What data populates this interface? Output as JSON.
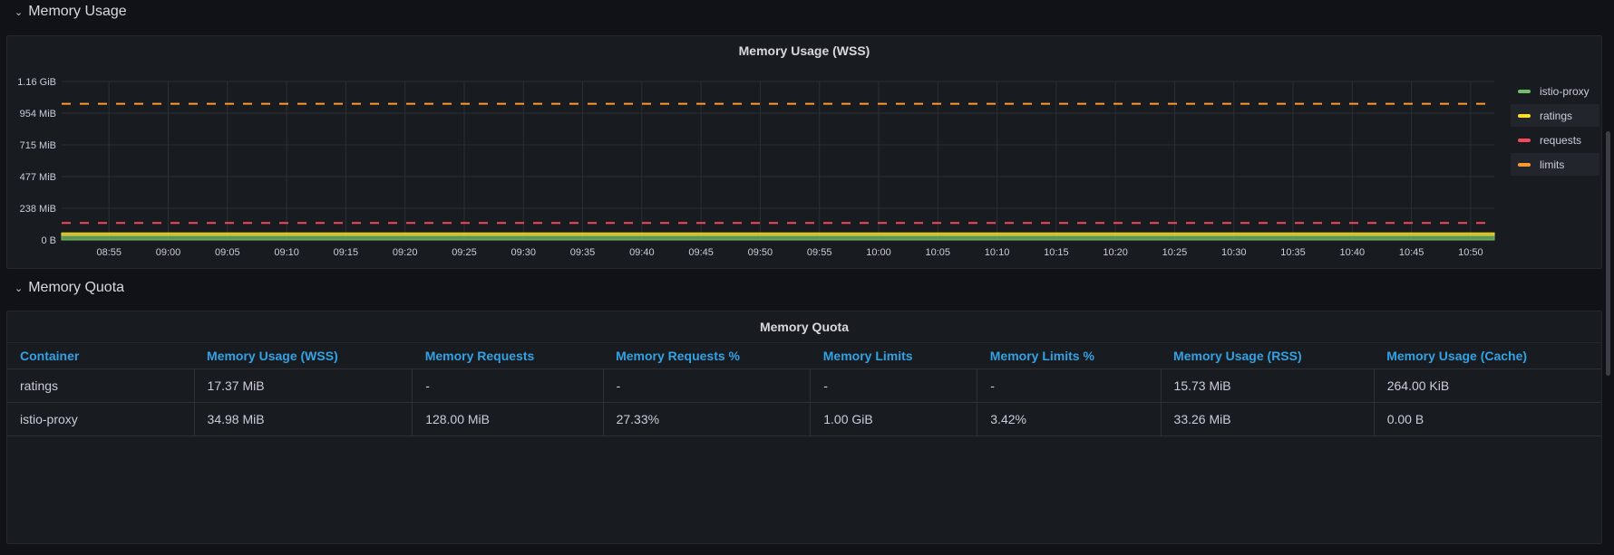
{
  "rows": {
    "memory_usage": "Memory Usage",
    "memory_quota": "Memory Quota"
  },
  "icons": {
    "collapse": "chevron-down-icon"
  },
  "colors": {
    "istio_proxy": "#73bf69",
    "ratings": "#fade2a",
    "requests": "#f2495c",
    "limits": "#ff9830",
    "header_link": "#33a2e5"
  },
  "wss_panel": {
    "title": "Memory Usage (WSS)",
    "legend": [
      {
        "label": "istio-proxy",
        "color": "#73bf69",
        "highlight": false
      },
      {
        "label": "ratings",
        "color": "#fade2a",
        "highlight": true
      },
      {
        "label": "requests",
        "color": "#f2495c",
        "highlight": false
      },
      {
        "label": "limits",
        "color": "#ff9830",
        "highlight": true
      }
    ]
  },
  "chart_data": {
    "type": "area",
    "title": "Memory Usage (WSS)",
    "y_tick_labels": [
      "0 B",
      "238 MiB",
      "477 MiB",
      "715 MiB",
      "954 MiB",
      "1.16 GiB"
    ],
    "y_tick_values_mib": [
      0,
      238,
      477,
      715,
      954,
      1192
    ],
    "ylim_mib": [
      0,
      1192
    ],
    "x_tick_labels": [
      "08:55",
      "09:00",
      "09:05",
      "09:10",
      "09:15",
      "09:20",
      "09:25",
      "09:30",
      "09:35",
      "09:40",
      "09:45",
      "09:50",
      "09:55",
      "10:00",
      "10:05",
      "10:10",
      "10:15",
      "10:20",
      "10:25",
      "10:30",
      "10:35",
      "10:40",
      "10:45",
      "10:50"
    ],
    "x_range": [
      "08:51",
      "10:52"
    ],
    "grid": true,
    "legend_placement": "right",
    "series": [
      {
        "name": "istio-proxy",
        "kind": "stacked-area",
        "color": "#73bf69",
        "values_mib": [
          35,
          35,
          35,
          35,
          35,
          35
        ]
      },
      {
        "name": "ratings",
        "kind": "stacked-area",
        "color": "#fade2a",
        "values_mib": [
          17.4,
          17.4,
          17.4,
          17.4,
          17.4,
          17.4
        ]
      },
      {
        "name": "requests",
        "kind": "dashed-line",
        "color": "#f2495c",
        "value_mib": 128
      },
      {
        "name": "limits",
        "kind": "dashed-line",
        "color": "#ff9830",
        "value_mib": 1024
      }
    ]
  },
  "quota_panel": {
    "title": "Memory Quota",
    "columns": [
      "Container",
      "Memory Usage (WSS)",
      "Memory Requests",
      "Memory Requests %",
      "Memory Limits",
      "Memory Limits %",
      "Memory Usage (RSS)",
      "Memory Usage (Cache)"
    ],
    "rows": [
      [
        "ratings",
        "17.37 MiB",
        "-",
        "-",
        "-",
        "-",
        "15.73 MiB",
        "264.00 KiB"
      ],
      [
        "istio-proxy",
        "34.98 MiB",
        "128.00 MiB",
        "27.33%",
        "1.00 GiB",
        "3.42%",
        "33.26 MiB",
        "0.00 B"
      ]
    ]
  }
}
